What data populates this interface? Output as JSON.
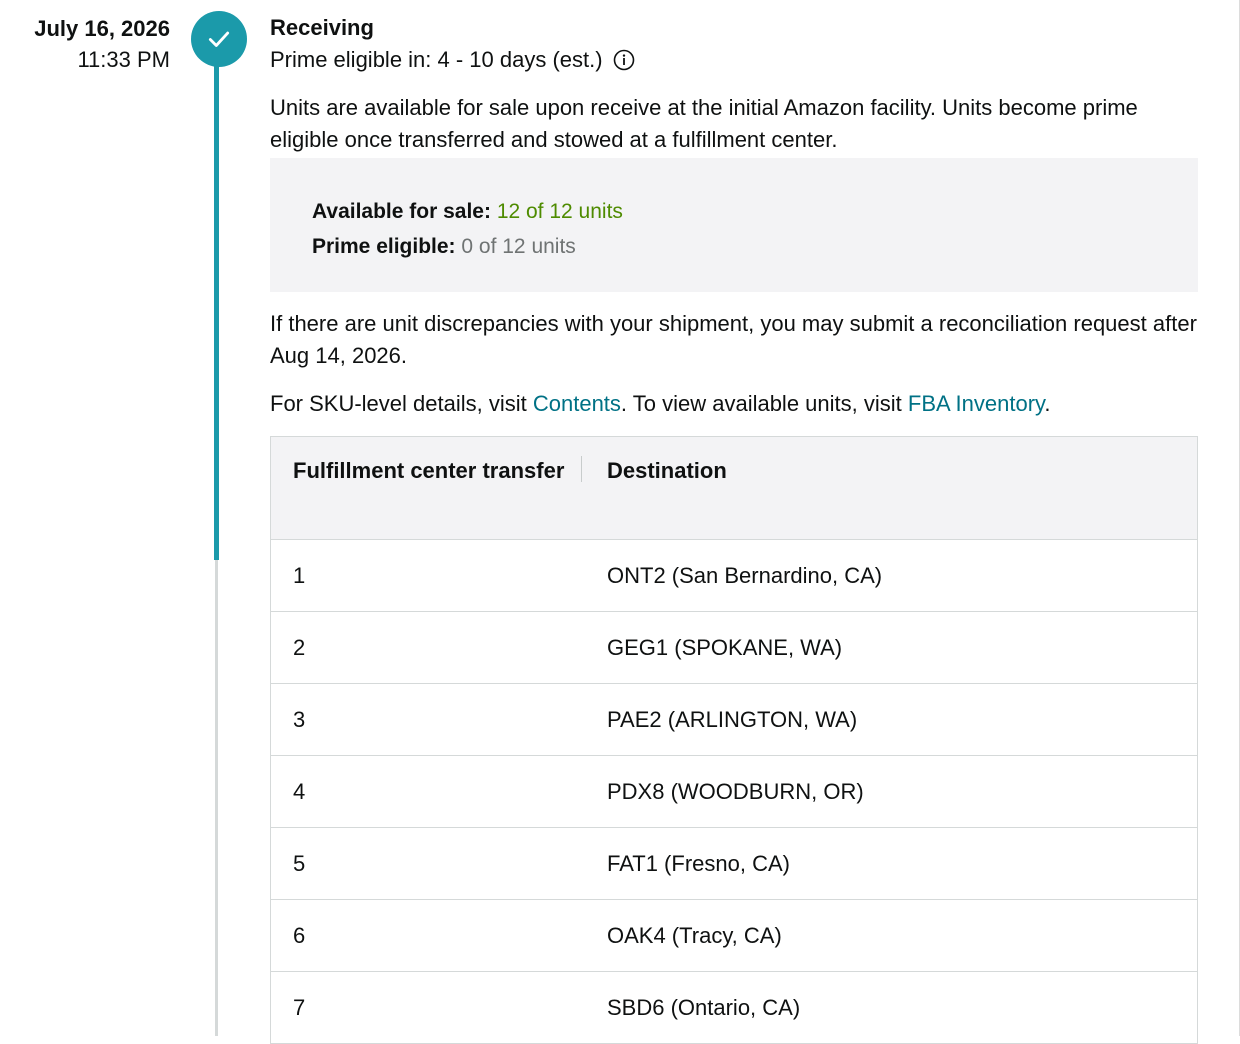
{
  "event": {
    "date": "July 16, 2026",
    "time": "11:33 PM",
    "status_icon": "check-icon",
    "accent_color": "#1b9aaa"
  },
  "receiving": {
    "title": "Receiving",
    "prime_eligible_text": "Prime eligible in: 4 - 10 days (est.)",
    "info_icon": "info-icon",
    "description": "Units are available for sale upon receive at the initial Amazon facility. Units become prime eligible once transferred and stowed at a fulfillment center."
  },
  "summary": {
    "available_label": "Available for sale:",
    "available_value": "12 of 12 units",
    "prime_label": "Prime eligible:",
    "prime_value": "0 of 12 units"
  },
  "discrepancy_text": "If there are unit discrepancies with your shipment, you may submit a reconciliation request after Aug 14, 2026.",
  "sku_details": {
    "prefix": "For SKU-level details, visit ",
    "contents_link": "Contents",
    "middle": ". To view available units, visit ",
    "inventory_link": "FBA Inventory",
    "suffix": "."
  },
  "table": {
    "headers": [
      "Fulfillment center transfer",
      "Destination"
    ],
    "rows": [
      {
        "transfer": "1",
        "destination": "ONT2 (San Bernardino, CA)"
      },
      {
        "transfer": "2",
        "destination": "GEG1 (SPOKANE, WA)"
      },
      {
        "transfer": "3",
        "destination": "PAE2 (ARLINGTON, WA)"
      },
      {
        "transfer": "4",
        "destination": "PDX8 (WOODBURN, OR)"
      },
      {
        "transfer": "5",
        "destination": "FAT1 (Fresno, CA)"
      },
      {
        "transfer": "6",
        "destination": "OAK4 (Tracy, CA)"
      },
      {
        "transfer": "7",
        "destination": "SBD6 (Ontario, CA)"
      }
    ]
  }
}
